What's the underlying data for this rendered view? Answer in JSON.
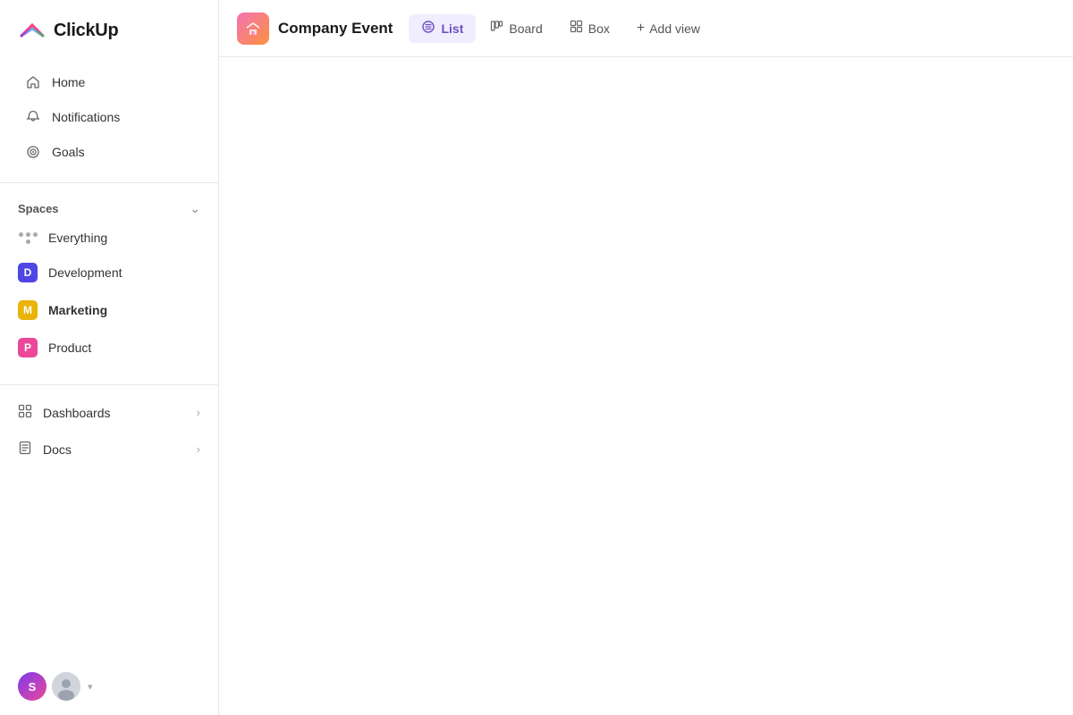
{
  "app": {
    "name": "ClickUp"
  },
  "sidebar": {
    "logo_text": "ClickUp",
    "nav_items": [
      {
        "id": "home",
        "label": "Home"
      },
      {
        "id": "notifications",
        "label": "Notifications"
      },
      {
        "id": "goals",
        "label": "Goals"
      }
    ],
    "spaces_section": {
      "title": "Spaces",
      "items": [
        {
          "id": "everything",
          "label": "Everything",
          "type": "dots"
        },
        {
          "id": "development",
          "label": "Development",
          "type": "avatar",
          "color": "#4f46e5",
          "letter": "D"
        },
        {
          "id": "marketing",
          "label": "Marketing",
          "type": "avatar",
          "color": "#eab308",
          "letter": "M",
          "bold": true
        },
        {
          "id": "product",
          "label": "Product",
          "type": "avatar",
          "color": "#ec4899",
          "letter": "P"
        }
      ]
    },
    "section_items": [
      {
        "id": "dashboards",
        "label": "Dashboards"
      },
      {
        "id": "docs",
        "label": "Docs"
      }
    ]
  },
  "topbar": {
    "workspace_name": "Company Event",
    "tabs": [
      {
        "id": "list",
        "label": "List",
        "active": true
      },
      {
        "id": "board",
        "label": "Board",
        "active": false
      },
      {
        "id": "box",
        "label": "Box",
        "active": false
      }
    ],
    "add_view_label": "Add view"
  },
  "footer": {
    "initials": "S"
  }
}
